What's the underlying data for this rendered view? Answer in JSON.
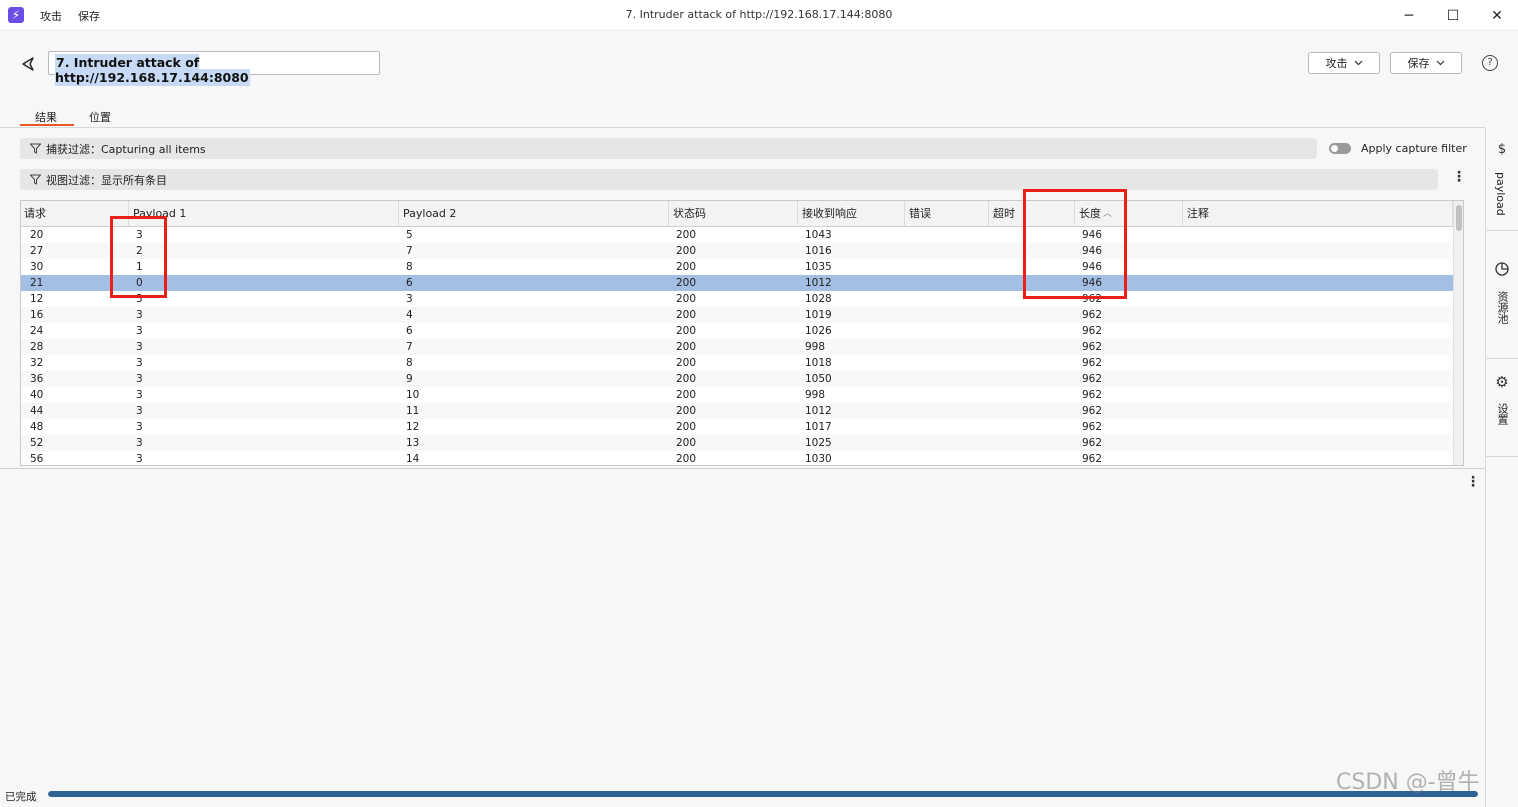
{
  "window": {
    "title": "7. Intruder attack of http://192.168.17.144:8080",
    "menu": [
      "攻击",
      "保存"
    ],
    "controls": {
      "minimize": "─",
      "maximize": "☐",
      "close": "✕"
    }
  },
  "header": {
    "tab_name": "7. Intruder attack of http://192.168.17.144:8080",
    "attack_button": "攻击",
    "save_button": "保存",
    "help": "?"
  },
  "subtabs": {
    "results": "结果",
    "positions": "位置",
    "active": "结果"
  },
  "capture_filter": {
    "label": "捕获过滤：Capturing all items",
    "toggle_label": "Apply capture filter",
    "toggle_on": false
  },
  "view_filter": {
    "label": "视图过滤：显示所有条目"
  },
  "table": {
    "columns": [
      "请求",
      "Payload 1",
      "Payload 2",
      "状态码",
      "接收到响应",
      "错误",
      "超时",
      "长度",
      "注释"
    ],
    "sorted_column": "长度",
    "sort_direction": "ascending",
    "rows": [
      [
        "20",
        "3",
        "5",
        "200",
        "1043",
        "",
        "",
        "946",
        ""
      ],
      [
        "27",
        "2",
        "7",
        "200",
        "1016",
        "",
        "",
        "946",
        ""
      ],
      [
        "30",
        "1",
        "8",
        "200",
        "1035",
        "",
        "",
        "946",
        ""
      ],
      [
        "21",
        "0",
        "6",
        "200",
        "1012",
        "",
        "",
        "946",
        ""
      ],
      [
        "12",
        "3",
        "3",
        "200",
        "1028",
        "",
        "",
        "962",
        ""
      ],
      [
        "16",
        "3",
        "4",
        "200",
        "1019",
        "",
        "",
        "962",
        ""
      ],
      [
        "24",
        "3",
        "6",
        "200",
        "1026",
        "",
        "",
        "962",
        ""
      ],
      [
        "28",
        "3",
        "7",
        "200",
        "998",
        "",
        "",
        "962",
        ""
      ],
      [
        "32",
        "3",
        "8",
        "200",
        "1018",
        "",
        "",
        "962",
        ""
      ],
      [
        "36",
        "3",
        "9",
        "200",
        "1050",
        "",
        "",
        "962",
        ""
      ],
      [
        "40",
        "3",
        "10",
        "200",
        "998",
        "",
        "",
        "962",
        ""
      ],
      [
        "44",
        "3",
        "11",
        "200",
        "1012",
        "",
        "",
        "962",
        ""
      ],
      [
        "48",
        "3",
        "12",
        "200",
        "1017",
        "",
        "",
        "962",
        ""
      ],
      [
        "52",
        "3",
        "13",
        "200",
        "1025",
        "",
        "",
        "962",
        ""
      ],
      [
        "56",
        "3",
        "14",
        "200",
        "1030",
        "",
        "",
        "962",
        ""
      ]
    ],
    "selected_row": 3
  },
  "sidebar": {
    "items": [
      {
        "label": "payload",
        "icon": "dollar-icon"
      },
      {
        "label": "资源池",
        "icon": "resource-pool-icon"
      },
      {
        "label": "设置",
        "icon": "gear-icon"
      }
    ]
  },
  "status": {
    "text": "已完成",
    "progress": 1.0
  },
  "watermark": "CSDN @-曾牛",
  "colors": {
    "accent_underline": "#e8582a",
    "selection": "#a4bfe4",
    "highlight_box": "#e8201a",
    "progress": "#2e6294"
  }
}
